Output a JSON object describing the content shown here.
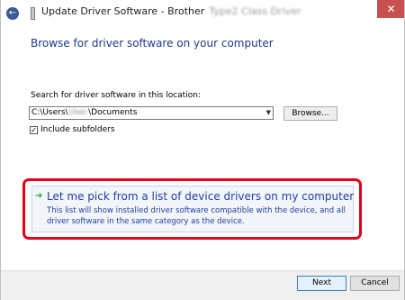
{
  "window": {
    "title": "Update Driver Software - Brother",
    "title_redacted": "Type2 Class Driver",
    "close_label": "✕",
    "back_glyph": "←"
  },
  "main": {
    "heading": "Browse for driver software on your computer",
    "search_label": "Search for driver software in this location:",
    "path_prefix": "C:\\Users\\",
    "path_redacted": "User",
    "path_suffix": "\\Documents",
    "browse_label": "Browse...",
    "include_subfolders_label": "Include subfolders",
    "include_subfolders_checked": true
  },
  "option": {
    "title": "Let me pick from a list of device drivers on my computer",
    "description": "This list will show installed driver software compatible with the device, and all driver software in the same category as the device."
  },
  "footer": {
    "next_label": "Next",
    "cancel_label": "Cancel"
  },
  "colors": {
    "link_blue": "#1f3fa5",
    "highlight_red": "#e2001a",
    "close_red": "#c75050"
  }
}
